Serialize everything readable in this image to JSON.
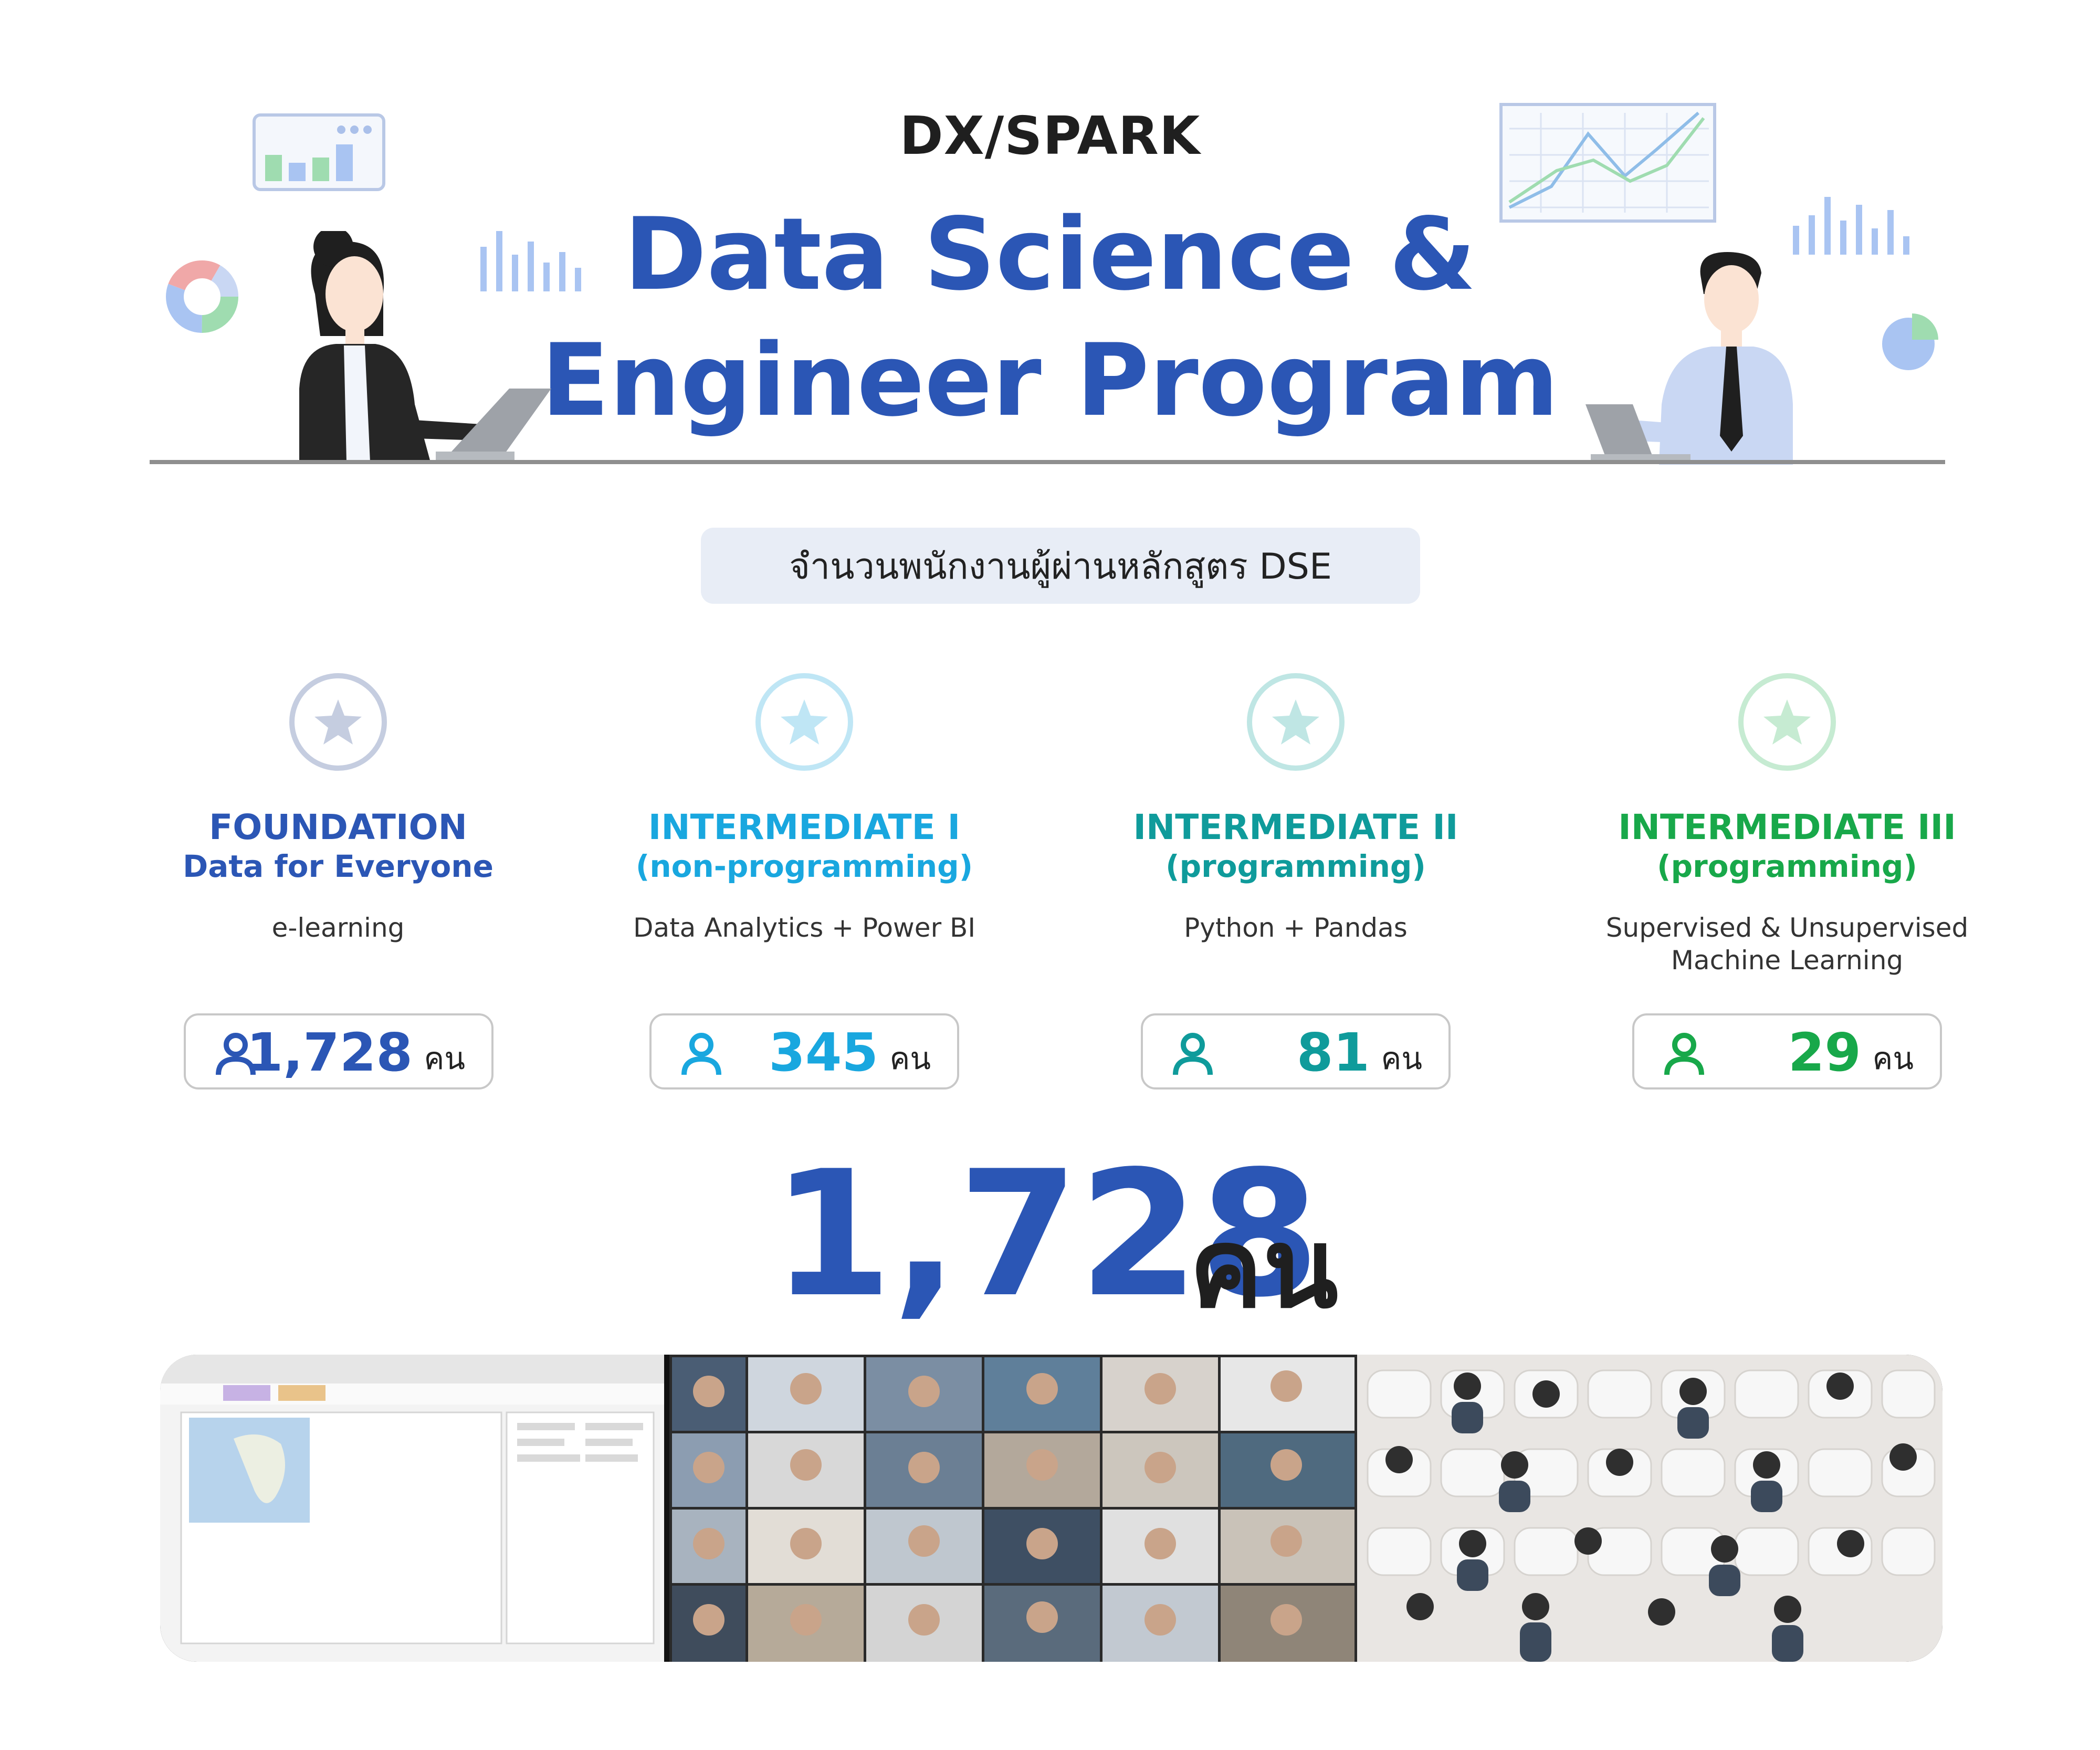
{
  "header": {
    "brand": "DX/SPARK",
    "title_line1": "Data Science &",
    "title_line2": "Engineer Program"
  },
  "summary_label": "จำนวนพนักงานผู้ผ่านหลักสูตร DSE",
  "levels": [
    {
      "title": "FOUNDATION",
      "subtitle": "Data for Everyone",
      "desc_line1": "e-learning",
      "desc_line2": "",
      "count": "1,728",
      "unit": "คน",
      "color": "#2b56b5",
      "badge_color": "#c5cde0"
    },
    {
      "title": "INTERMEDIATE I",
      "subtitle": "(non-programming)",
      "desc_line1": "Data Analytics + Power BI",
      "desc_line2": "",
      "count": "345",
      "unit": "คน",
      "color": "#19a7df",
      "badge_color": "#bfe6f5"
    },
    {
      "title": "INTERMEDIATE II",
      "subtitle": "(programming)",
      "desc_line1": "Python + Pandas",
      "desc_line2": "",
      "count": "81",
      "unit": "คน",
      "color": "#0f9b9b",
      "badge_color": "#bfe6e4"
    },
    {
      "title": "INTERMEDIATE III",
      "subtitle": "(programming)",
      "desc_line1": "Supervised & Unsupervised",
      "desc_line2": "Machine Learning",
      "count": "29",
      "unit": "คน",
      "color": "#18a84a",
      "badge_color": "#c6ebd2"
    }
  ],
  "total": {
    "count": "1,728",
    "unit": "คน"
  },
  "colors": {
    "primary": "#2b56b5",
    "pill_bg": "#e8edf6"
  }
}
